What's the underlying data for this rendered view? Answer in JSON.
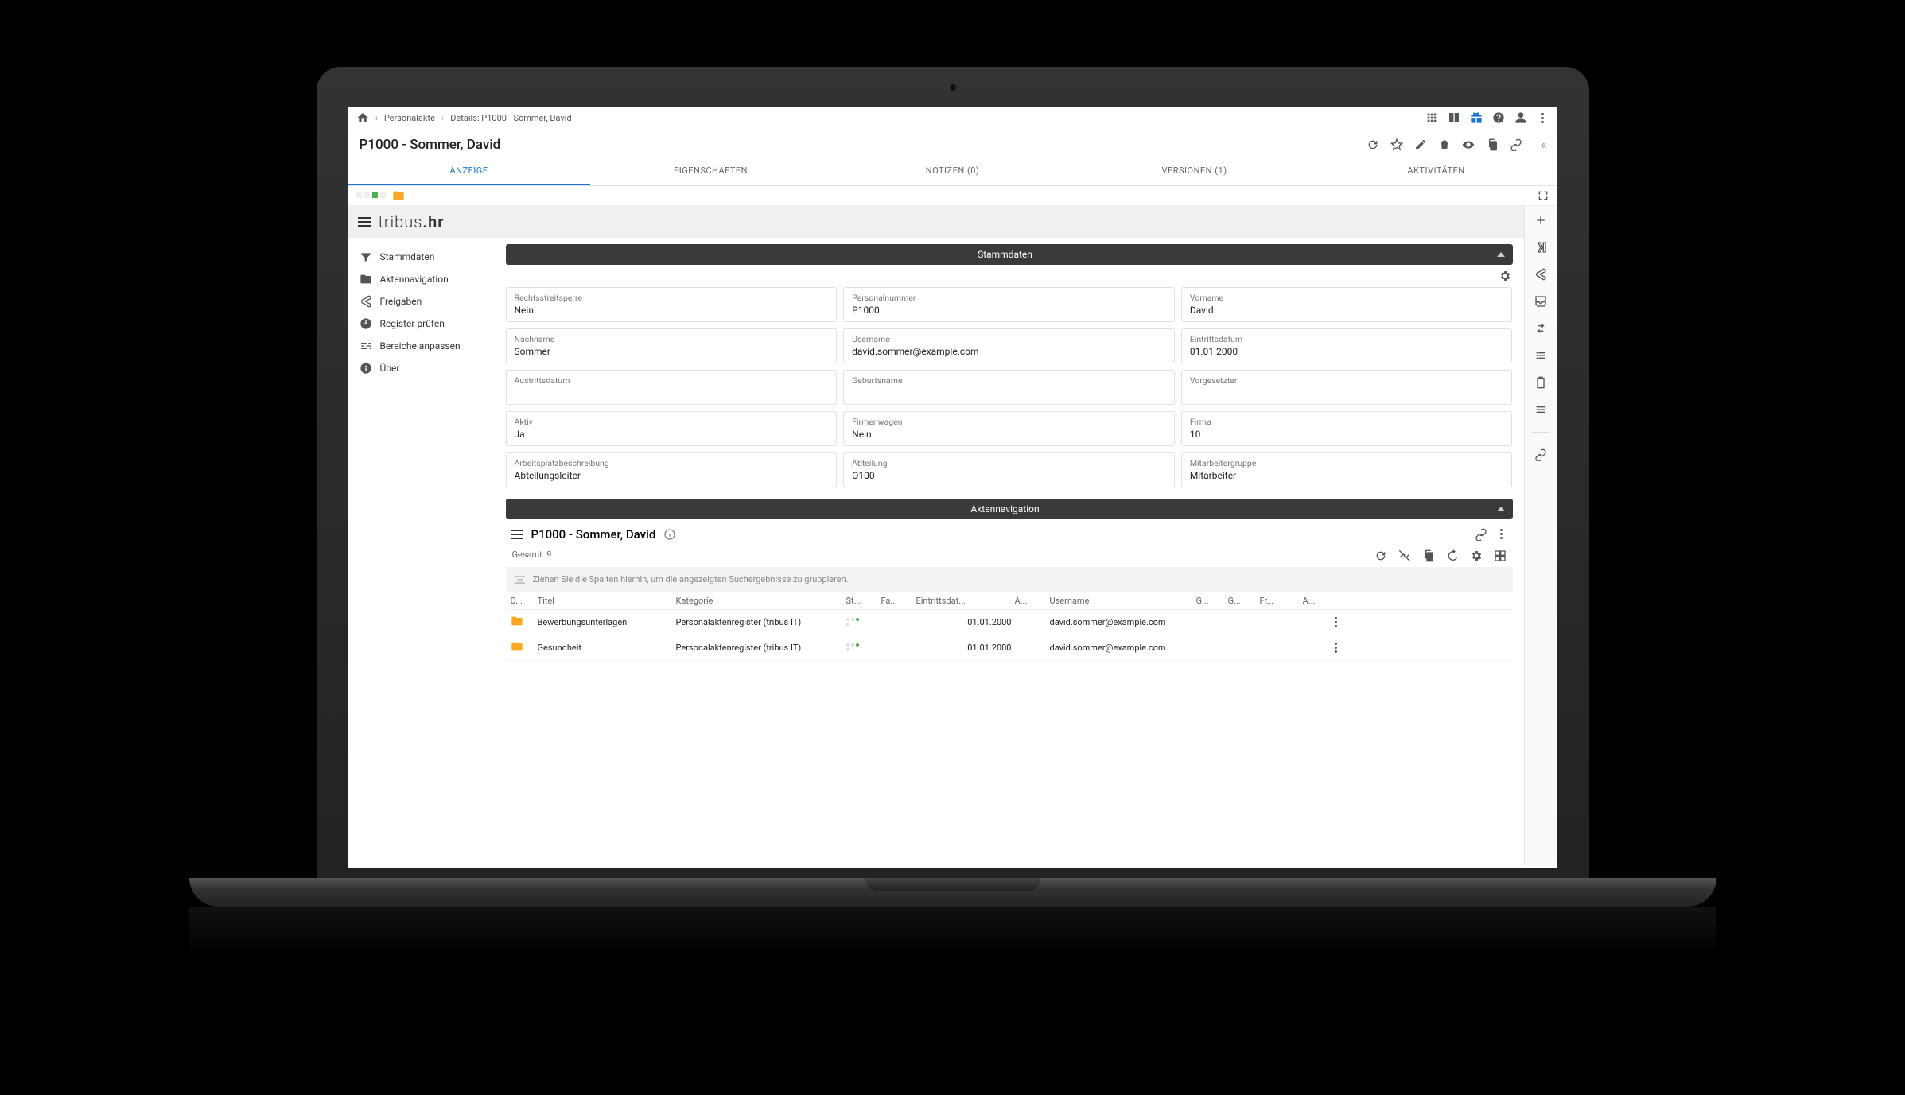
{
  "breadcrumbs": {
    "root": "Personalakte",
    "detail": "Details: P1000 - Sommer, David"
  },
  "title": "P1000 - Sommer, David",
  "tabs": [
    {
      "label": "ANZEIGE",
      "active": true
    },
    {
      "label": "EIGENSCHAFTEN"
    },
    {
      "label": "NOTIZEN (0)"
    },
    {
      "label": "VERSIONEN (1)"
    },
    {
      "label": "AKTIVITÄTEN"
    }
  ],
  "brand_a": "tribus",
  "brand_b": ".hr",
  "sidenav": [
    {
      "icon": "filter",
      "label": "Stammdaten"
    },
    {
      "icon": "folder",
      "label": "Aktennavigation"
    },
    {
      "icon": "share",
      "label": "Freigaben"
    },
    {
      "icon": "clock",
      "label": "Register prüfen"
    },
    {
      "icon": "tune",
      "label": "Bereiche anpassen"
    },
    {
      "icon": "info",
      "label": "Über"
    }
  ],
  "panel1_title": "Stammdaten",
  "fields": [
    {
      "label": "Rechtsstreitsperre",
      "value": "Nein"
    },
    {
      "label": "Personalnummer",
      "value": "P1000"
    },
    {
      "label": "Vorname",
      "value": "David"
    },
    {
      "label": "Nachname",
      "value": "Sommer"
    },
    {
      "label": "Username",
      "value": "david.sommer@example.com"
    },
    {
      "label": "Eintrittsdatum",
      "value": "01.01.2000"
    },
    {
      "label": "Austrittsdatum",
      "value": ""
    },
    {
      "label": "Geburtsname",
      "value": ""
    },
    {
      "label": "Vorgesetzter",
      "value": ""
    },
    {
      "label": "Aktiv",
      "value": "Ja"
    },
    {
      "label": "Firmenwagen",
      "value": "Nein"
    },
    {
      "label": "Firma",
      "value": "10"
    },
    {
      "label": "Arbeitsplatzbeschreibung",
      "value": "Abteilungsleiter"
    },
    {
      "label": "Abteilung",
      "value": "O100"
    },
    {
      "label": "Mitarbeitergruppe",
      "value": "Mitarbeiter"
    }
  ],
  "panel2_title": "Aktennavigation",
  "nav_title": "P1000 - Sommer, David",
  "nav_count": "Gesamt: 9",
  "group_hint": "Ziehen Sie die Spalten hierhin, um die angezeigten Suchergebnisse zu gruppieren.",
  "columns": [
    "D...",
    "Titel",
    "Kategorie",
    "St...",
    "Fa...",
    "Eintrittsdat...",
    "A...",
    "Username",
    "G...",
    "G...",
    "Fr...",
    "A..."
  ],
  "rows": [
    {
      "titel": "Bewerbungsunterlagen",
      "kat": "Personalaktenregister (tribus IT)",
      "ein": "01.01.2000",
      "user": "david.sommer@example.com"
    },
    {
      "titel": "Gesundheit",
      "kat": "Personalaktenregister (tribus IT)",
      "ein": "01.01.2000",
      "user": "david.sommer@example.com"
    }
  ]
}
